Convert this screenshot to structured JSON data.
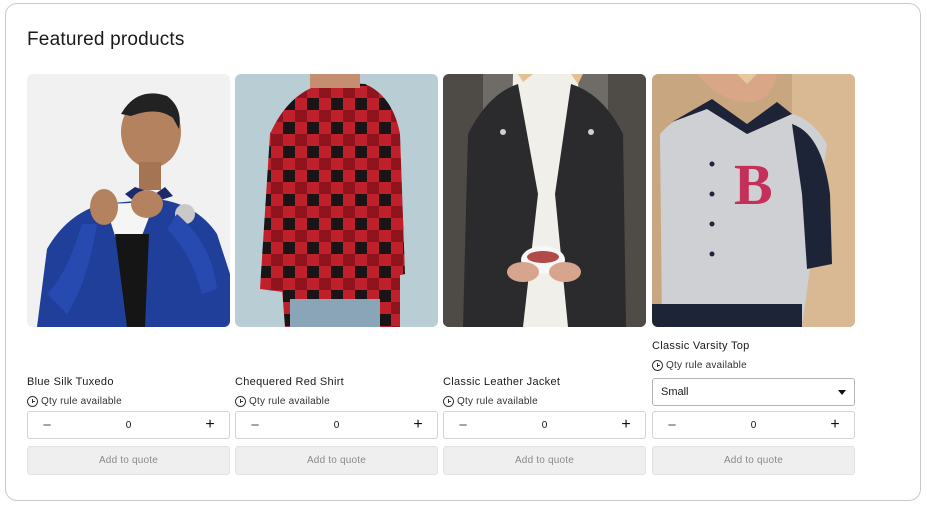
{
  "section": {
    "title": "Featured products"
  },
  "products": [
    {
      "name": "Blue Silk Tuxedo",
      "qty_rule": "Qty rule available",
      "quantity": "0",
      "add_label": "Add to quote",
      "minus": "−",
      "plus": "+"
    },
    {
      "name": "Chequered Red Shirt",
      "qty_rule": "Qty rule available",
      "quantity": "0",
      "add_label": "Add to quote",
      "minus": "−",
      "plus": "+"
    },
    {
      "name": "Classic Leather Jacket",
      "qty_rule": "Qty rule available",
      "quantity": "0",
      "add_label": "Add to quote",
      "minus": "−",
      "plus": "+"
    },
    {
      "name": "Classic Varsity Top",
      "qty_rule": "Qty rule available",
      "variant_selected": "Small",
      "quantity": "0",
      "add_label": "Add to quote",
      "minus": "−",
      "plus": "+"
    }
  ],
  "colors": {
    "accent_disabled_button": "#efefef",
    "text_muted": "#8a8a8a"
  }
}
